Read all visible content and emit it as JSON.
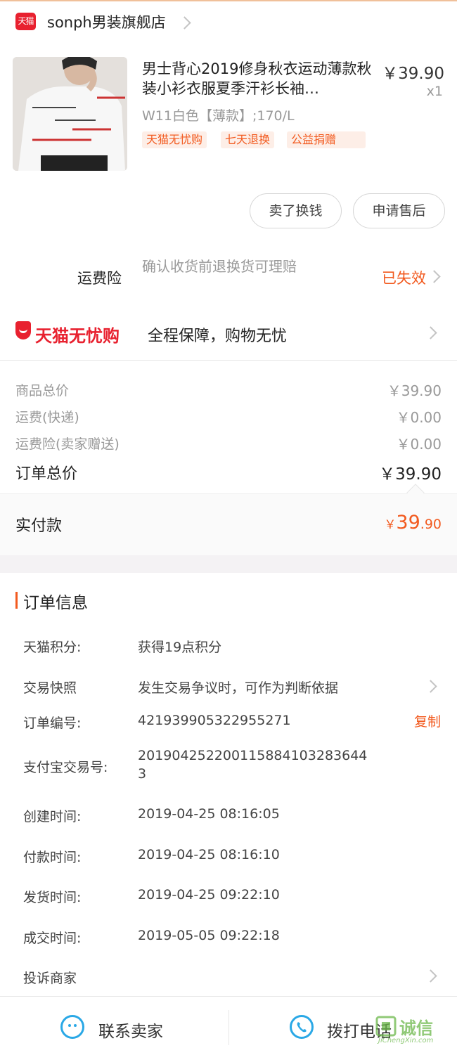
{
  "shop": {
    "logo_text": "天猫",
    "name": "sonph男装旗舰店"
  },
  "product": {
    "title": "男士背心2019修身秋衣运动薄款秋装小衫衣服夏季汗衫长袖…",
    "price": "￥39.90",
    "quantity": "x1",
    "sku": "W11白色【薄款】;170/L",
    "tags": [
      "天猫无忧购",
      "七天退换",
      "公益捐赠"
    ]
  },
  "actions": {
    "sell_label": "卖了换钱",
    "aftersale_label": "申请售后"
  },
  "insurance": {
    "label": "运费险",
    "description": "确认收货前退换货可理赔",
    "status": "已失效"
  },
  "wuyou": {
    "brand": "天猫无忧购",
    "text": "全程保障，购物无忧"
  },
  "summary": {
    "rows": [
      {
        "label": "商品总价",
        "value": "￥39.90"
      },
      {
        "label": "运费(快递)",
        "value": "￥0.00"
      },
      {
        "label": "运费险(卖家赠送)",
        "value": "￥0.00"
      }
    ],
    "total_label": "订单总价",
    "total_value": "￥39.90"
  },
  "payment": {
    "label": "实付款",
    "currency": "￥",
    "integer": "39",
    "decimal": ".90"
  },
  "order_info": {
    "title": "订单信息",
    "rows": [
      {
        "label": "天猫积分:",
        "value": "获得19点积分"
      },
      {
        "label": "交易快照",
        "value": "发生交易争议时，可作为判断依据"
      },
      {
        "label": "订单编号:",
        "value": "421939905322955271"
      },
      {
        "label": "支付宝交易号:",
        "value": "20190425220011588410328364 43"
      },
      {
        "label": "创建时间:",
        "value": "2019-04-25 08:16:05"
      },
      {
        "label": "付款时间:",
        "value": "2019-04-25 08:16:10"
      },
      {
        "label": "发货时间:",
        "value": "2019-04-25 09:22:10"
      },
      {
        "label": "成交时间:",
        "value": "2019-05-05 09:22:18"
      }
    ],
    "alipay_line1": "201904252200115884103283644",
    "alipay_line2": "3",
    "copy_label": "复制",
    "complain_label": "投诉商家"
  },
  "bottom": {
    "contact_label": "联系卖家",
    "call_label": "拨打电话"
  },
  "watermark": {
    "text": "诚信",
    "sub": "JiChengXin.com"
  },
  "colors": {
    "accent": "#f25a1f",
    "tmall_red": "#e8212f",
    "icon_blue": "#2aa8e6"
  }
}
